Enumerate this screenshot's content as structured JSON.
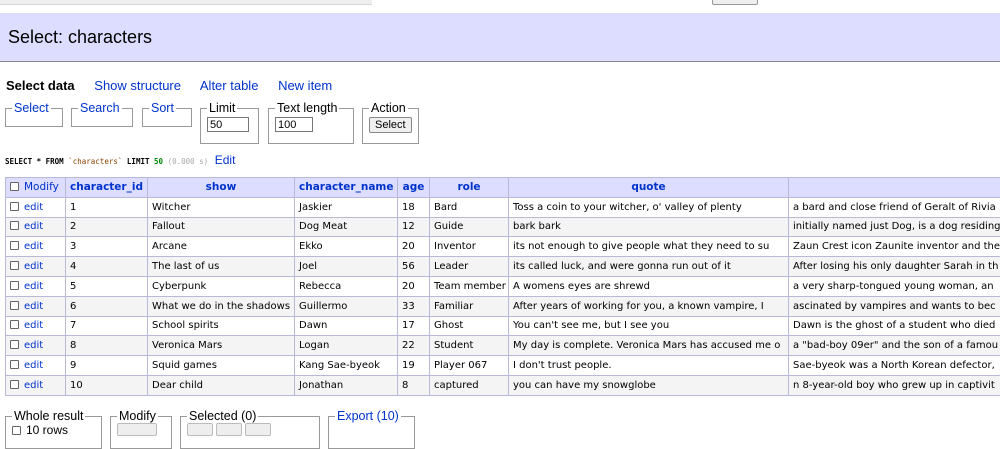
{
  "header": {
    "title": "Select: characters"
  },
  "links": {
    "select_data": "Select data",
    "show_structure": "Show structure",
    "alter_table": "Alter table",
    "new_item": "New item"
  },
  "controls": {
    "select": "Select",
    "search": "Search",
    "sort": "Sort",
    "limit": "Limit",
    "limit_value": "50",
    "text_length": "Text length",
    "text_length_value": "100",
    "action": "Action",
    "action_button": "Select"
  },
  "sql": {
    "prefix": "SELECT * FROM",
    "table": "`characters`",
    "limit_kw": "LIMIT",
    "limit": "50",
    "time": "(0.000 s)",
    "edit": "Edit"
  },
  "table": {
    "modify_label": "Modify",
    "columns": [
      "character_id",
      "show",
      "character_name",
      "age",
      "role",
      "quote",
      ""
    ],
    "edit_label": "edit",
    "rows": [
      [
        "1",
        "Witcher",
        "Jaskier",
        "18",
        "Bard",
        "Toss a coin to your witcher, o' valley of plenty",
        "a bard and close friend of Geralt of Rivia"
      ],
      [
        "2",
        "Fallout",
        "Dog Meat",
        "12",
        "Guide",
        "bark bark",
        "initially named just Dog, is a dog residing"
      ],
      [
        "3",
        "Arcane",
        "Ekko",
        "20",
        "Inventor",
        "its not enough to give people what they need to su",
        "Zaun Crest icon Zaunite inventor and the"
      ],
      [
        "4",
        "The last of us",
        "Joel",
        "56",
        "Leader",
        "its called luck, and were gonna run out of it",
        "After losing his only daughter Sarah in th"
      ],
      [
        "5",
        "Cyberpunk",
        "Rebecca",
        "20",
        "Team member",
        "A womens eyes are shrewd",
        "a very sharp-tongued young woman, an"
      ],
      [
        "6",
        "What we do in the shadows",
        "Guillermo",
        "33",
        "Familiar",
        "After years of working for you, a known vampire, I",
        "ascinated by vampires and wants to bec"
      ],
      [
        "7",
        "School spirits",
        "Dawn",
        "17",
        "Ghost",
        "You can't see me, but I see you",
        "Dawn is the ghost of a student who died"
      ],
      [
        "8",
        "Veronica Mars",
        "Logan",
        "22",
        "Student",
        "My day is complete. Veronica Mars has accused me o",
        "a \"bad-boy 09er\" and the son of a famou"
      ],
      [
        "9",
        "Squid games",
        "Kang Sae-byeok",
        "19",
        "Player 067",
        "I don't trust people.",
        "Sae-byeok was a North Korean defector,"
      ],
      [
        "10",
        "Dear child",
        "Jonathan",
        "8",
        "captured",
        "you can have my snowglobe",
        "n 8-year-old boy who grew up in captivit"
      ]
    ]
  },
  "bottom": {
    "whole_result": "Whole result",
    "rows_label": "10 rows",
    "modify": "Modify",
    "selected": "Selected (0)",
    "export": "Export (10)"
  }
}
